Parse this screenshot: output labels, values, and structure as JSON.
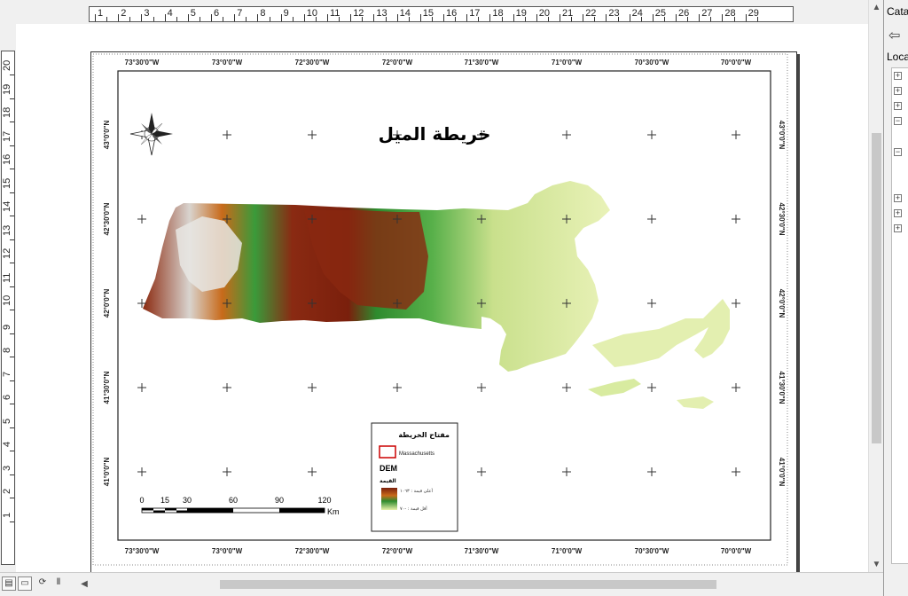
{
  "ruler": {
    "h_labels": [
      "1",
      "2",
      "3",
      "4",
      "5",
      "6",
      "7",
      "8",
      "9",
      "10",
      "11",
      "12",
      "13",
      "14",
      "15",
      "16",
      "17",
      "18",
      "19",
      "20",
      "21",
      "22",
      "23",
      "24",
      "25",
      "26",
      "27",
      "28",
      "29"
    ],
    "v_labels": [
      "20",
      "19",
      "18",
      "17",
      "16",
      "15",
      "14",
      "13",
      "12",
      "11",
      "10",
      "9",
      "8",
      "7",
      "6",
      "5",
      "4",
      "3",
      "2",
      "1"
    ]
  },
  "map": {
    "title": "خريطة الميل",
    "top_lon": [
      "73°30'0\"W",
      "73°0'0\"W",
      "72°30'0\"W",
      "72°0'0\"W",
      "71°30'0\"W",
      "71°0'0\"W",
      "70°30'0\"W",
      "70°0'0\"W"
    ],
    "bottom_lon": [
      "73°30'0\"W",
      "73°0'0\"W",
      "72°30'0\"W",
      "72°0'0\"W",
      "71°30'0\"W",
      "71°0'0\"W",
      "70°30'0\"W",
      "70°0'0\"W"
    ],
    "left_lat": [
      "43°0'0\"N",
      "42°30'0\"N",
      "42°0'0\"N",
      "41°30'0\"N",
      "41°0'0\"N"
    ],
    "right_lat": [
      "43°0'0\"N",
      "42°30'0\"N",
      "42°0'0\"N",
      "41°30'0\"N",
      "41°0'0\"N"
    ]
  },
  "legend": {
    "title": "مفتاح الخريطة",
    "boundary_label": "Massachusetts",
    "dem_label": "DEM",
    "value_label": "القيمة",
    "high": "أعلى قيمة : ١٠٦٣",
    "low": "أقل قيمة : -٧٠"
  },
  "scalebar": {
    "ticks": [
      "0",
      "15",
      "30",
      "60",
      "90",
      "120"
    ],
    "unit": "Km"
  },
  "catalog": {
    "title": "Catalog",
    "location_label": "Location"
  },
  "colors": {
    "high_elev": "#7a1f0c",
    "mid_elev": "#2e8b2e",
    "low_elev": "#e6f0a8",
    "boundary": "#cc0000"
  }
}
